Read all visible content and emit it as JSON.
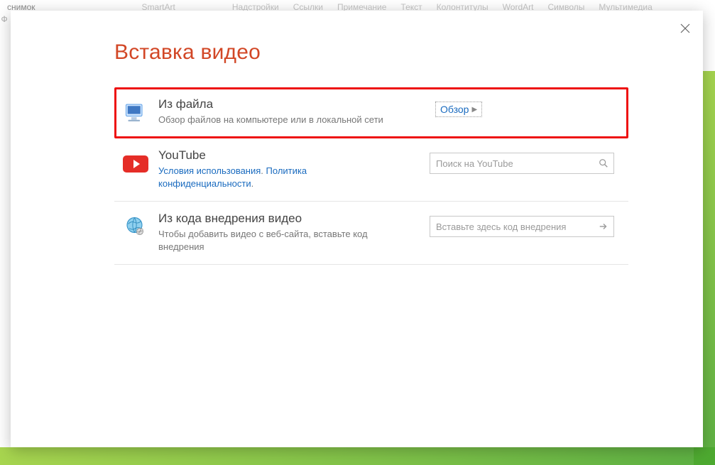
{
  "ribbon": {
    "fragments": [
      "снимок",
      "SmartArt",
      "Надстройки",
      "Ссылки",
      "Примечание",
      "Текст",
      "Колонтитулы",
      "WordArt",
      "Символы",
      "Мультимедиа"
    ],
    "left_edge": "Ф"
  },
  "modal": {
    "title": "Вставка видео"
  },
  "sources": {
    "file": {
      "title": "Из файла",
      "desc": "Обзор файлов на компьютере или в локальной сети",
      "action": "Обзор"
    },
    "youtube": {
      "title": "YouTube",
      "terms_text": "Условия использования",
      "privacy_text": "Политика конфиденциальности",
      "separator": ". ",
      "trailing": ".",
      "search_placeholder": "Поиск на YouTube"
    },
    "embed": {
      "title": "Из кода внедрения видео",
      "desc": "Чтобы добавить видео с веб-сайта, вставьте код внедрения",
      "embed_placeholder": "Вставьте здесь код внедрения"
    }
  }
}
